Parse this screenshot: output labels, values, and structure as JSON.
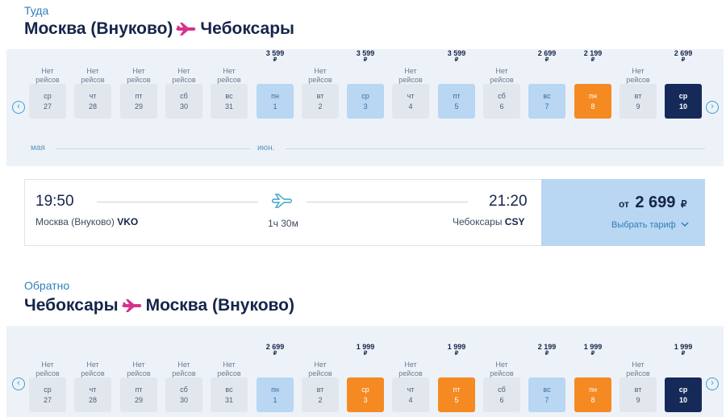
{
  "outbound": {
    "label": "Туда",
    "from": "Москва (Внуково)",
    "to": "Чебоксары",
    "months": [
      "мая",
      "июн."
    ],
    "days": [
      {
        "price": "",
        "no_flights": "Нет рейсов",
        "dow": "ср",
        "date": "27",
        "state": "none"
      },
      {
        "price": "",
        "no_flights": "Нет рейсов",
        "dow": "чт",
        "date": "28",
        "state": "none"
      },
      {
        "price": "",
        "no_flights": "Нет рейсов",
        "dow": "пт",
        "date": "29",
        "state": "none"
      },
      {
        "price": "",
        "no_flights": "Нет рейсов",
        "dow": "сб",
        "date": "30",
        "state": "none"
      },
      {
        "price": "",
        "no_flights": "Нет рейсов",
        "dow": "вс",
        "date": "31",
        "state": "none"
      },
      {
        "price": "3 599",
        "no_flights": "",
        "dow": "пн",
        "date": "1",
        "state": "avail"
      },
      {
        "price": "",
        "no_flights": "Нет рейсов",
        "dow": "вт",
        "date": "2",
        "state": "none"
      },
      {
        "price": "3 599",
        "no_flights": "",
        "dow": "ср",
        "date": "3",
        "state": "avail"
      },
      {
        "price": "",
        "no_flights": "Нет рейсов",
        "dow": "чт",
        "date": "4",
        "state": "none"
      },
      {
        "price": "3 599",
        "no_flights": "",
        "dow": "пт",
        "date": "5",
        "state": "avail"
      },
      {
        "price": "",
        "no_flights": "Нет рейсов",
        "dow": "сб",
        "date": "6",
        "state": "none"
      },
      {
        "price": "2 699",
        "no_flights": "",
        "dow": "вс",
        "date": "7",
        "state": "avail"
      },
      {
        "price": "2 199",
        "no_flights": "",
        "dow": "пн",
        "date": "8",
        "state": "cheap"
      },
      {
        "price": "",
        "no_flights": "Нет рейсов",
        "dow": "вт",
        "date": "9",
        "state": "none"
      },
      {
        "price": "2 699",
        "no_flights": "",
        "dow": "ср",
        "date": "10",
        "state": "sel"
      }
    ]
  },
  "flight": {
    "depart_time": "19:50",
    "depart_city": "Москва (Внуково)",
    "depart_code": "VKO",
    "arrive_time": "21:20",
    "arrive_city": "Чебоксары",
    "arrive_code": "CSY",
    "duration": "1ч 30м",
    "price_prefix": "от",
    "price": "2 699",
    "currency": "₽",
    "choose_fare": "Выбрать тариф"
  },
  "return": {
    "label": "Обратно",
    "from": "Чебоксары",
    "to": "Москва (Внуково)",
    "days": [
      {
        "price": "",
        "no_flights": "Нет рейсов",
        "dow": "ср",
        "date": "27",
        "state": "none"
      },
      {
        "price": "",
        "no_flights": "Нет рейсов",
        "dow": "чт",
        "date": "28",
        "state": "none"
      },
      {
        "price": "",
        "no_flights": "Нет рейсов",
        "dow": "пт",
        "date": "29",
        "state": "none"
      },
      {
        "price": "",
        "no_flights": "Нет рейсов",
        "dow": "сб",
        "date": "30",
        "state": "none"
      },
      {
        "price": "",
        "no_flights": "Нет рейсов",
        "dow": "вс",
        "date": "31",
        "state": "none"
      },
      {
        "price": "2 699",
        "no_flights": "",
        "dow": "пн",
        "date": "1",
        "state": "avail"
      },
      {
        "price": "",
        "no_flights": "Нет рейсов",
        "dow": "вт",
        "date": "2",
        "state": "none"
      },
      {
        "price": "1 999",
        "no_flights": "",
        "dow": "ср",
        "date": "3",
        "state": "cheap"
      },
      {
        "price": "",
        "no_flights": "Нет рейсов",
        "dow": "чт",
        "date": "4",
        "state": "none"
      },
      {
        "price": "1 999",
        "no_flights": "",
        "dow": "пт",
        "date": "5",
        "state": "cheap"
      },
      {
        "price": "",
        "no_flights": "Нет рейсов",
        "dow": "сб",
        "date": "6",
        "state": "none"
      },
      {
        "price": "2 199",
        "no_flights": "",
        "dow": "вс",
        "date": "7",
        "state": "avail"
      },
      {
        "price": "1 999",
        "no_flights": "",
        "dow": "пн",
        "date": "8",
        "state": "cheap"
      },
      {
        "price": "",
        "no_flights": "Нет рейсов",
        "dow": "вт",
        "date": "9",
        "state": "none"
      },
      {
        "price": "1 999",
        "no_flights": "",
        "dow": "ср",
        "date": "10",
        "state": "sel"
      }
    ]
  },
  "currency_symbol": "₽",
  "icons": {
    "nav_prev": "chevron-left-icon",
    "nav_next": "chevron-right-icon",
    "plane": "airplane-icon",
    "dropdown": "chevron-down-icon"
  },
  "colors": {
    "accent_pink": "#d6338d",
    "selected": "#162a5a",
    "cheap": "#f58a23",
    "available": "#b9d6f2",
    "no_flights": "#e2e7ee",
    "link": "#2f7fb8"
  }
}
